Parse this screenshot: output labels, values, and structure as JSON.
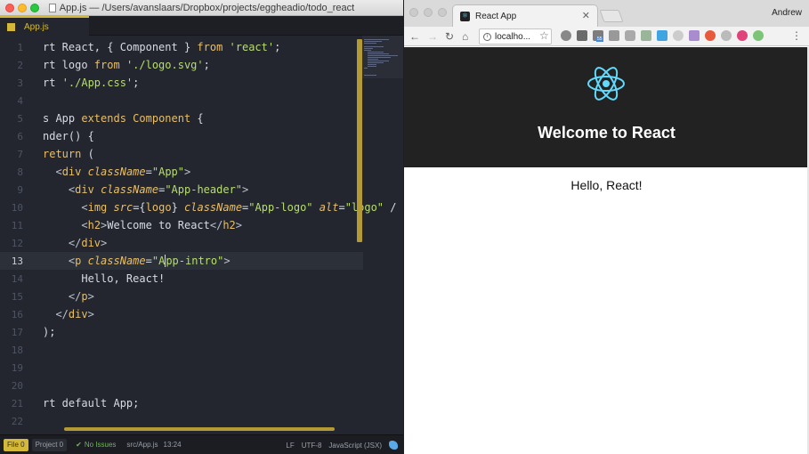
{
  "editor": {
    "title": "App.js — /Users/avanslaars/Dropbox/projects/eggheadio/todo_react",
    "tab": "App.js",
    "lines": [
      {
        "n": "1",
        "html": "rt React, { Component } <span class=\"kw\">from</span> <span class=\"str\">'react'</span>;"
      },
      {
        "n": "2",
        "html": "rt logo <span class=\"kw\">from</span> <span class=\"str\">'./logo.svg'</span>;"
      },
      {
        "n": "3",
        "html": "rt <span class=\"str\">'./App.css'</span>;"
      },
      {
        "n": "4",
        "html": ""
      },
      {
        "n": "5",
        "html": "s App <span class=\"kw\">extends</span> <span class=\"kw\">Component</span> {"
      },
      {
        "n": "6",
        "html": "nder() {"
      },
      {
        "n": "7",
        "html": "<span class=\"kw\">return</span> ("
      },
      {
        "n": "8",
        "html": "  <span class=\"punc\">&lt;</span><span class=\"kw\">div</span> <span class=\"attr\">className</span>=<span class=\"str\">\"App\"</span><span class=\"punc\">&gt;</span>"
      },
      {
        "n": "9",
        "html": "    <span class=\"punc\">&lt;</span><span class=\"kw\">div</span> <span class=\"attr\">className</span>=<span class=\"str\">\"App-header\"</span><span class=\"punc\">&gt;</span>"
      },
      {
        "n": "10",
        "html": "      <span class=\"punc\">&lt;</span><span class=\"kw\">img</span> <span class=\"attr\">src</span>={<span class=\"kw\">logo</span>} <span class=\"attr\">className</span>=<span class=\"str\">\"App-logo\"</span> <span class=\"attr\">alt</span>=<span class=\"str\">\"logo\"</span> /"
      },
      {
        "n": "11",
        "html": "      <span class=\"punc\">&lt;</span><span class=\"kw\">h2</span><span class=\"punc\">&gt;</span>Welcome to React<span class=\"punc\">&lt;/</span><span class=\"kw\">h2</span><span class=\"punc\">&gt;</span>"
      },
      {
        "n": "12",
        "html": "    <span class=\"punc\">&lt;/</span><span class=\"kw\">div</span><span class=\"punc\">&gt;</span>"
      },
      {
        "n": "13",
        "html": "    <span class=\"punc\">&lt;</span><span class=\"kw\">p</span> <span class=\"attr\">className</span>=<span class=\"str\">\"A<span class=\"cursor\"></span>pp-intro\"</span><span class=\"punc\">&gt;</span>",
        "active": true
      },
      {
        "n": "14",
        "html": "      Hello, React!"
      },
      {
        "n": "15",
        "html": "    <span class=\"punc\">&lt;/</span><span class=\"kw\">p</span><span class=\"punc\">&gt;</span>"
      },
      {
        "n": "16",
        "html": "  <span class=\"punc\">&lt;/</span><span class=\"kw\">div</span><span class=\"punc\">&gt;</span>"
      },
      {
        "n": "17",
        "html": ");"
      },
      {
        "n": "18",
        "html": ""
      },
      {
        "n": "19",
        "html": ""
      },
      {
        "n": "20",
        "html": ""
      },
      {
        "n": "21",
        "html": "rt default App;"
      },
      {
        "n": "22",
        "html": ""
      }
    ],
    "status": {
      "file": "File 0",
      "project": "Project 0",
      "issues": "No Issues",
      "path": "src/App.js",
      "position": "13:24",
      "eol": "LF",
      "encoding": "UTF-8",
      "grammar": "JavaScript (JSX)"
    }
  },
  "browser": {
    "tab_title": "React App",
    "profile": "Andrew",
    "url": "localho...",
    "header_title": "Welcome to React",
    "intro": "Hello, React!",
    "ext_badge": "55",
    "colors": {
      "accent": "#d4b83a",
      "react": "#61dafb",
      "header_bg": "#222222"
    }
  }
}
